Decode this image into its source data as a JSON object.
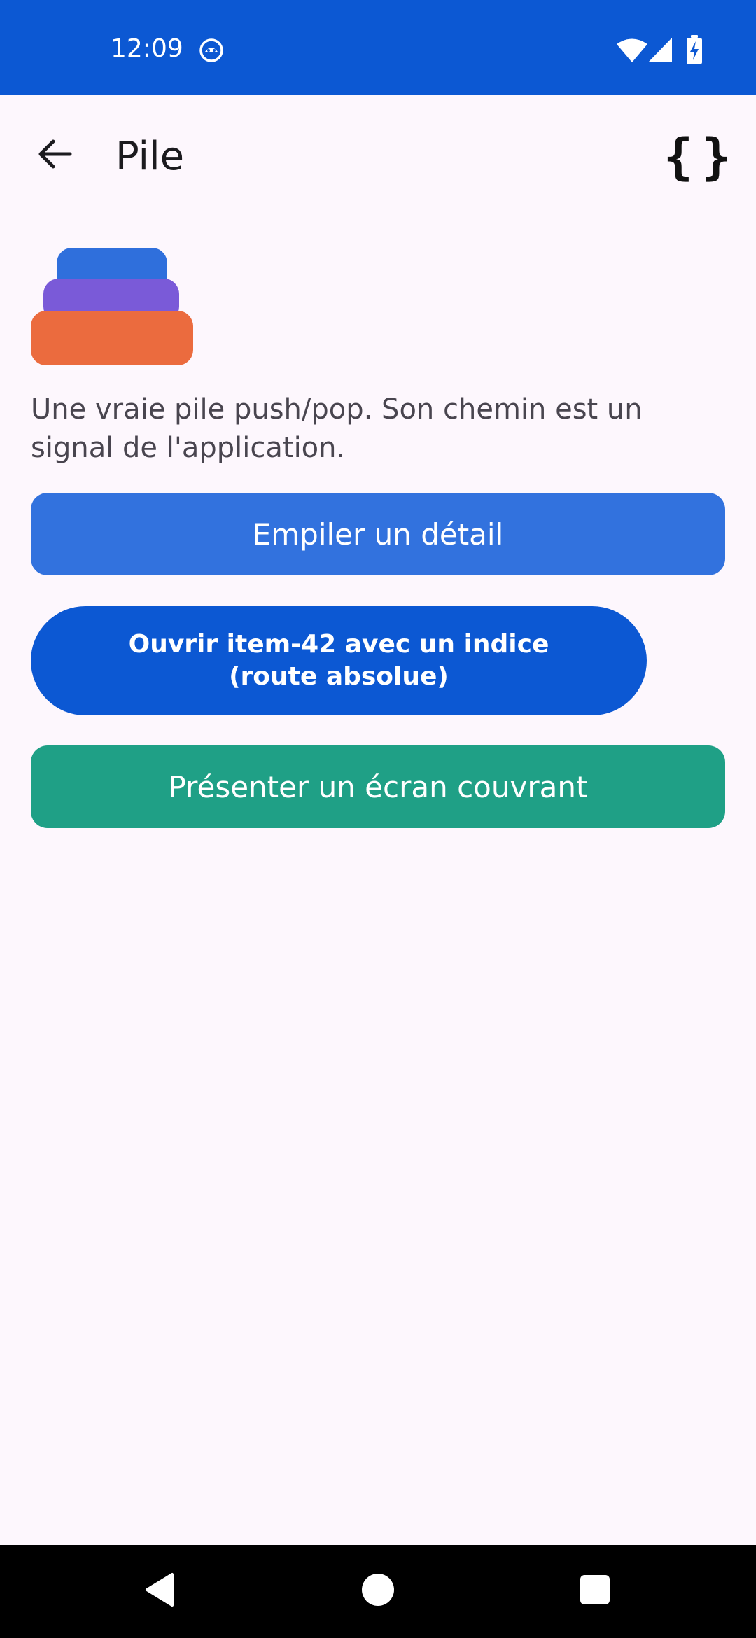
{
  "status_bar": {
    "time": "12:09",
    "icons": [
      "notification-app-icon",
      "wifi-icon",
      "cell-signal-icon",
      "battery-charging-icon"
    ]
  },
  "app_bar": {
    "title": "Pile",
    "back_icon": "arrow-back-icon",
    "action_icon": "code-braces-icon",
    "action_label": "{}"
  },
  "main": {
    "illustration": "stack-icon",
    "description": "Une vraie pile push/pop. Son chemin est un signal de l'application.",
    "buttons": [
      {
        "label": "Empiler un détail",
        "color": "#3272de"
      },
      {
        "label": "Ouvrir item-42 avec un indice (route absolue)",
        "color": "#0c58d3"
      },
      {
        "label": "Présenter un écran couvrant",
        "color": "#1fa086"
      }
    ]
  },
  "nav_bar": {
    "icons": [
      "nav-back-icon",
      "nav-home-icon",
      "nav-recents-icon"
    ]
  },
  "colors": {
    "status_bar": "#0c58d3",
    "background": "#fdf7fd",
    "stack_top": "#2f6fdc",
    "stack_middle": "#7a5ad8",
    "stack_bottom": "#eb6b3e"
  }
}
